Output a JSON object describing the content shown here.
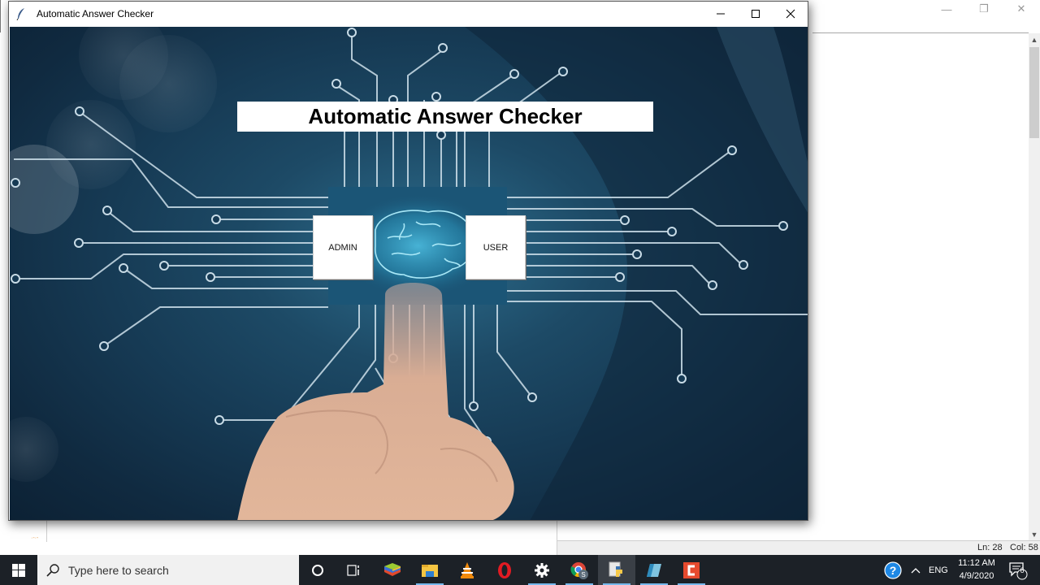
{
  "background_editor": {
    "status_line": "Ln: 28",
    "status_col": "Col: 58"
  },
  "window": {
    "title": "Automatic Answer Checker",
    "minimize_glyph": "—",
    "maximize_glyph": "☐",
    "close_glyph": "✕"
  },
  "app": {
    "heading": "Automatic Answer Checker",
    "buttons": {
      "admin": "ADMIN",
      "user": "USER"
    }
  },
  "taskbar": {
    "search_placeholder": "Type here to search",
    "pinned": [
      {
        "name": "cortana",
        "label": "Cortana"
      },
      {
        "name": "task-view",
        "label": "Task View"
      },
      {
        "name": "bluestacks",
        "label": "BlueStacks"
      },
      {
        "name": "file-explorer",
        "label": "File Explorer"
      },
      {
        "name": "vlc",
        "label": "VLC media player"
      },
      {
        "name": "opera",
        "label": "Opera"
      },
      {
        "name": "settings",
        "label": "Settings"
      },
      {
        "name": "chrome",
        "label": "Google Chrome"
      },
      {
        "name": "python-idle",
        "label": "Python IDLE"
      },
      {
        "name": "notepad",
        "label": "Notepad"
      },
      {
        "name": "camtasia",
        "label": "Camtasia"
      }
    ],
    "tray": {
      "language": "ENG",
      "time": "11:12 AM",
      "date": "4/9/2020",
      "notification_count": "6"
    }
  },
  "colors": {
    "taskbar_bg": "#1c2127",
    "canvas_bg": "#163a54",
    "circuit_line": "#c8dbe6",
    "accent_run": "#76b9ed"
  }
}
